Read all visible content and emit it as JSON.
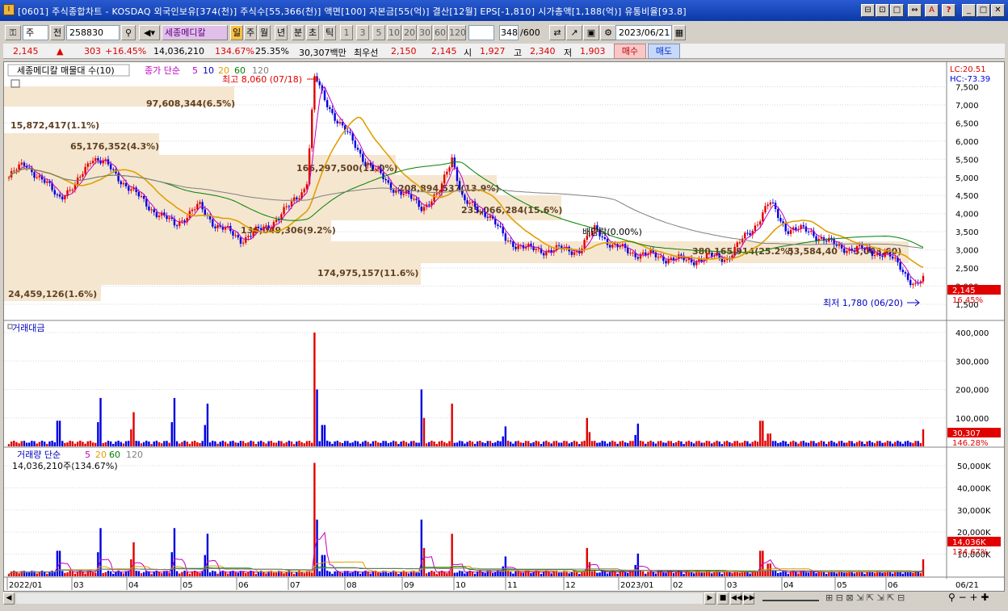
{
  "window": {
    "title": "[0601] 주식종합차트 - KOSDAQ 외국인보유[374(천)] 주식수[55,366(천)] 액면[100] 자본금[55(억)] 결산[12월] EPS[-1,810] 시가총액[1,188(억)] 유통비율[93.8]",
    "buttons": [
      "⊟",
      "⊡",
      "□",
      "⇔",
      "A",
      "?",
      "_",
      "□",
      "✕"
    ]
  },
  "toolbar": {
    "period_type": "주",
    "prev_label": "전",
    "code": "258830",
    "name": "세종메디칼",
    "period_tabs": [
      "일",
      "주",
      "월",
      "년",
      "분",
      "초",
      "틱"
    ],
    "active_tab": "일",
    "intervals": [
      "1",
      "3",
      "5",
      "10",
      "20",
      "30",
      "60",
      "120"
    ],
    "count": "348",
    "count_total": "/600",
    "date": "2023/06/21"
  },
  "quote": {
    "price": "2,145",
    "change": "303",
    "change_pct": "+16.45%",
    "volume": "14,036,210",
    "volume_ratio": "134.67%",
    "turnover": "25.35%",
    "amount": "30,307백만",
    "ask_label": "최우선",
    "ask": "2,150",
    "bid": "2,145",
    "open_label": "시",
    "open": "1,927",
    "high_label": "고",
    "high": "2,340",
    "low_label": "저",
    "low": "1,903",
    "buy_label": "매수",
    "sell_label": "매도"
  },
  "price_panel": {
    "legend_name": "세종메디칼 매물대 수(10)",
    "legend_ma": "종가 단순",
    "ma_periods": [
      "5",
      "10",
      "20",
      "60",
      "120"
    ],
    "lc_label": "LC:20.51",
    "hc_label": "HC:-73.39",
    "high_note": "최고 8,060 (07/18)",
    "low_note": "최저 1,780 (06/20)",
    "dividend_note": "배당락(0.00%)",
    "current_price_tag": "2,145",
    "current_pct_tag": "16.45%",
    "y_ticks": [
      "7,500",
      "7,000",
      "6,500",
      "6,000",
      "5,500",
      "5,000",
      "4,500",
      "4,000",
      "3,500",
      "3,000",
      "2,500",
      "2,000",
      "1,500"
    ],
    "volume_profile": [
      {
        "label": "97,608,344(6.5%)"
      },
      {
        "label": "15,872,417(1.1%)"
      },
      {
        "label": "65,176,352(4.3%)"
      },
      {
        "label": "166,297,500(11.0%)"
      },
      {
        "label": "208,894,537(13.9%)"
      },
      {
        "label": "235,066,284(15.6%)"
      },
      {
        "label": "136,049,306(9.2%)"
      },
      {
        "label": "380,165,914(25.2%)"
      },
      {
        "label": "53,584,40"
      },
      {
        "label": "3,003,60)"
      },
      {
        "label": "174,975,157(11.6%)"
      },
      {
        "label": "24,459,126(1.6%)"
      }
    ]
  },
  "amount_panel": {
    "title": "거래대금",
    "y_ticks": [
      "400,000",
      "300,000",
      "200,000",
      "100,000"
    ],
    "value_tag": "30,307",
    "pct_tag": "146.28%"
  },
  "volume_panel": {
    "legend": "거래량 단순",
    "ma_periods": [
      "5",
      "20",
      "60",
      "120"
    ],
    "value_line": "14,036,210주(134.67%)",
    "y_ticks": [
      "50,000K",
      "40,000K",
      "30,000K",
      "20,000K",
      "10,000K"
    ],
    "value_tag": "14,036K",
    "pct_tag": "134.67%"
  },
  "x_axis": {
    "labels": [
      "2022/01",
      "03",
      "04",
      "05",
      "06",
      "07",
      "08",
      "09",
      "10",
      "11",
      "12",
      "2023/01",
      "02",
      "03",
      "04",
      "05",
      "06"
    ],
    "last_date": "06/21"
  },
  "colors": {
    "up": "#e00000",
    "down": "#0000e0",
    "ma5": "#c000c0",
    "ma20": "#e0a000",
    "ma60": "#008000",
    "ma120": "#808080",
    "profile": "#f5e6d0"
  }
}
